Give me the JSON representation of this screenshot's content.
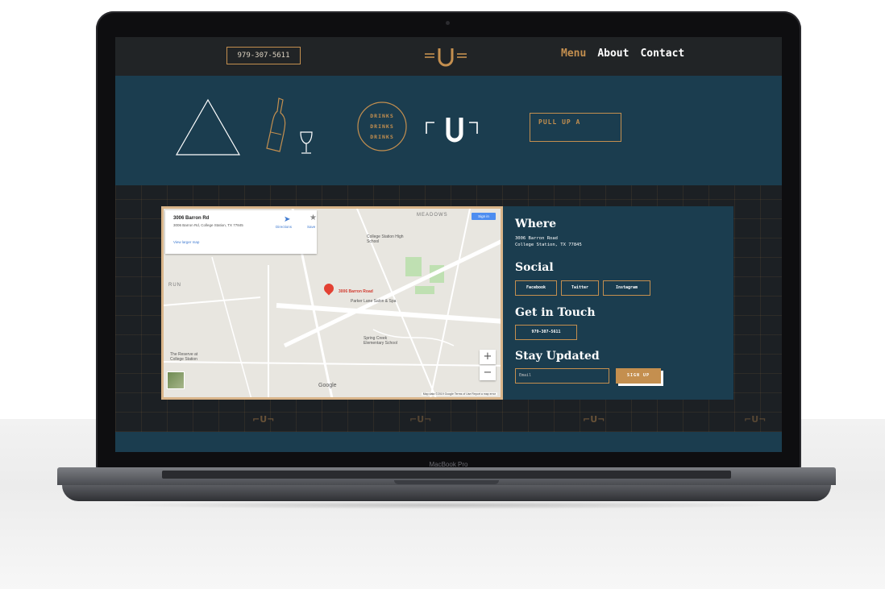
{
  "device": {
    "bezel_label": "MacBook Pro"
  },
  "nav": {
    "phone": "979-307-5611",
    "links": [
      {
        "label": "Menu",
        "active": true
      },
      {
        "label": "About",
        "active": false
      },
      {
        "label": "Contact",
        "active": false
      }
    ]
  },
  "hero": {
    "circle_lines": [
      "DRINKS",
      "DRINKS",
      "DRINKS"
    ],
    "pull_text": "PULL UP A"
  },
  "map": {
    "card_title": "3006 Barron Rd",
    "card_address": "3006 Barron Rd, College Station, TX 77845",
    "view_larger": "View larger map",
    "directions": "Directions",
    "save": "Save",
    "sign_in": "Sign in",
    "area_label": "MEADOWS",
    "pin_label": "3006 Barron Road",
    "places": [
      "College Station High School",
      "Parker Lane Salon & Spa",
      "Spring Creek Elementary School",
      "The Reserve at College Station"
    ],
    "run_label": "RUN",
    "zoom_in": "+",
    "zoom_out": "−",
    "google": "Google",
    "footer": "Map data ©2019 Google   Terms of Use   Report a map error"
  },
  "info": {
    "where_heading": "Where",
    "address_line1": "3006 Barron Road",
    "address_line2": "College Station, TX 77845",
    "social_heading": "Social",
    "social_links": [
      "Facebook",
      "Twitter",
      "Instagram"
    ],
    "touch_heading": "Get in Touch",
    "phone": "979-307-5611",
    "updates_heading": "Stay Updated",
    "email_placeholder": "Email",
    "signup_label": "SIGN UP"
  },
  "colors": {
    "accent": "#c48f4f",
    "teal": "#1b3d4f",
    "nav_bg": "#212426"
  }
}
